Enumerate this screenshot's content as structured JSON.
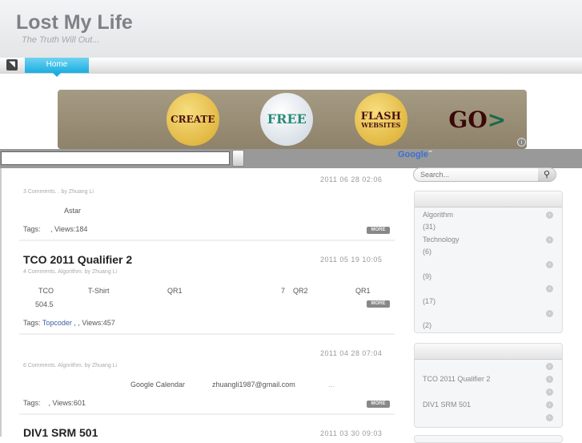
{
  "header": {
    "title": "Lost My Life",
    "tagline": "The Truth Will Out..."
  },
  "nav": {
    "rss_icon": "rss-icon",
    "home": "Home"
  },
  "banner": {
    "create": "CREATE",
    "free": "FREE",
    "flash": "FLASH",
    "websites": "WEBSITES",
    "go": "GO",
    "go_arrow": ">",
    "info": "i"
  },
  "google": {
    "logo": "Google",
    "tm": "™"
  },
  "posts": [
    {
      "title": "",
      "date": "2011 06 28  02:06",
      "meta": "3 Comments.      . by Zhuang Li",
      "body": [
        "Astar"
      ],
      "tags_label": "Tags:",
      "tag": "",
      "views": ", Views:184",
      "more": "MORE"
    },
    {
      "title": "TCO 2011 Qualifier 2",
      "date": "2011 05 19  10:05",
      "meta": "4 Comments. Algorithm. by Zhuang Li",
      "body": [
        "TCO",
        "T-Shirt",
        "QR1",
        "7",
        "QR2",
        "QR1",
        "504.5"
      ],
      "tags_label": "Tags:",
      "tag": "Topcoder",
      "views": ",      , Views:457",
      "more": "MORE"
    },
    {
      "title": "",
      "date": "2011 04 28  07:04",
      "meta": "6 Comments. Algorithm. by Zhuang Li",
      "body": [
        "Google Calendar",
        "zhuangli1987@gmail.com",
        "..."
      ],
      "tags_label": "Tags:",
      "tag": "",
      "views": ", Views:601",
      "more": "MORE"
    },
    {
      "title": "DIV1 SRM 501",
      "date": "2011 03 30  09:03"
    }
  ],
  "sidebar": {
    "search_placeholder": "Search...",
    "categories": [
      {
        "name": "Algorithm",
        "count": "(31)"
      },
      {
        "name": "Technology",
        "count": "(6)"
      },
      {
        "name": "",
        "count": "(9)"
      },
      {
        "name": "",
        "count": "(17)"
      },
      {
        "name": "",
        "count": "(2)"
      }
    ],
    "recent": [
      "",
      "TCO 2011 Qualifier 2",
      "",
      "DIV1 SRM 501",
      ""
    ]
  }
}
